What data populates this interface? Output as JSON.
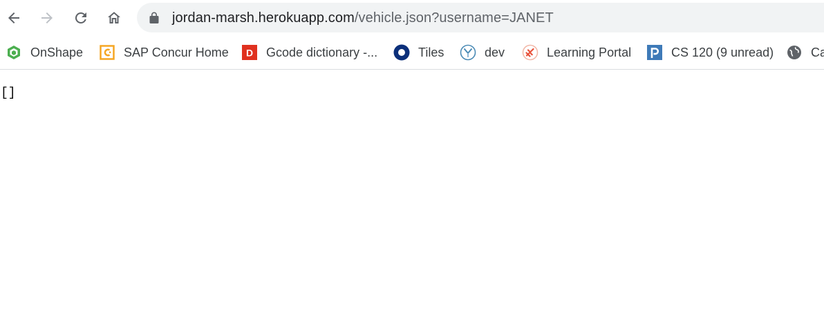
{
  "toolbar": {
    "back_icon": "arrow-left-icon",
    "forward_icon": "arrow-right-icon",
    "reload_icon": "reload-icon",
    "home_icon": "home-icon"
  },
  "address_bar": {
    "host": "jordan-marsh.herokuapp.com",
    "path": "/vehicle.json?username=JANET",
    "lock_icon": "lock-icon"
  },
  "bookmarks": [
    {
      "label": "OnShape",
      "icon": "onshape-icon",
      "color": "#4caf50"
    },
    {
      "label": "SAP Concur Home",
      "icon": "concur-icon",
      "color": "#f5a623"
    },
    {
      "label": "Gcode dictionary -...",
      "icon": "duet-d-icon",
      "color": "#e0311f"
    },
    {
      "label": "Tiles",
      "icon": "tiles-icon",
      "color": "#0b2f7a"
    },
    {
      "label": "dev",
      "icon": "dev-icon",
      "color": "#4a8ab5"
    },
    {
      "label": "Learning Portal",
      "icon": "learning-portal-icon",
      "color": "#e8523a"
    },
    {
      "label": "CS 120 (9 unread)",
      "icon": "piazza-icon",
      "color": "#3e7ab8"
    },
    {
      "label": "Ca",
      "icon": "globe-icon",
      "color": "#5f6368"
    }
  ],
  "page": {
    "body_text": "[]"
  }
}
